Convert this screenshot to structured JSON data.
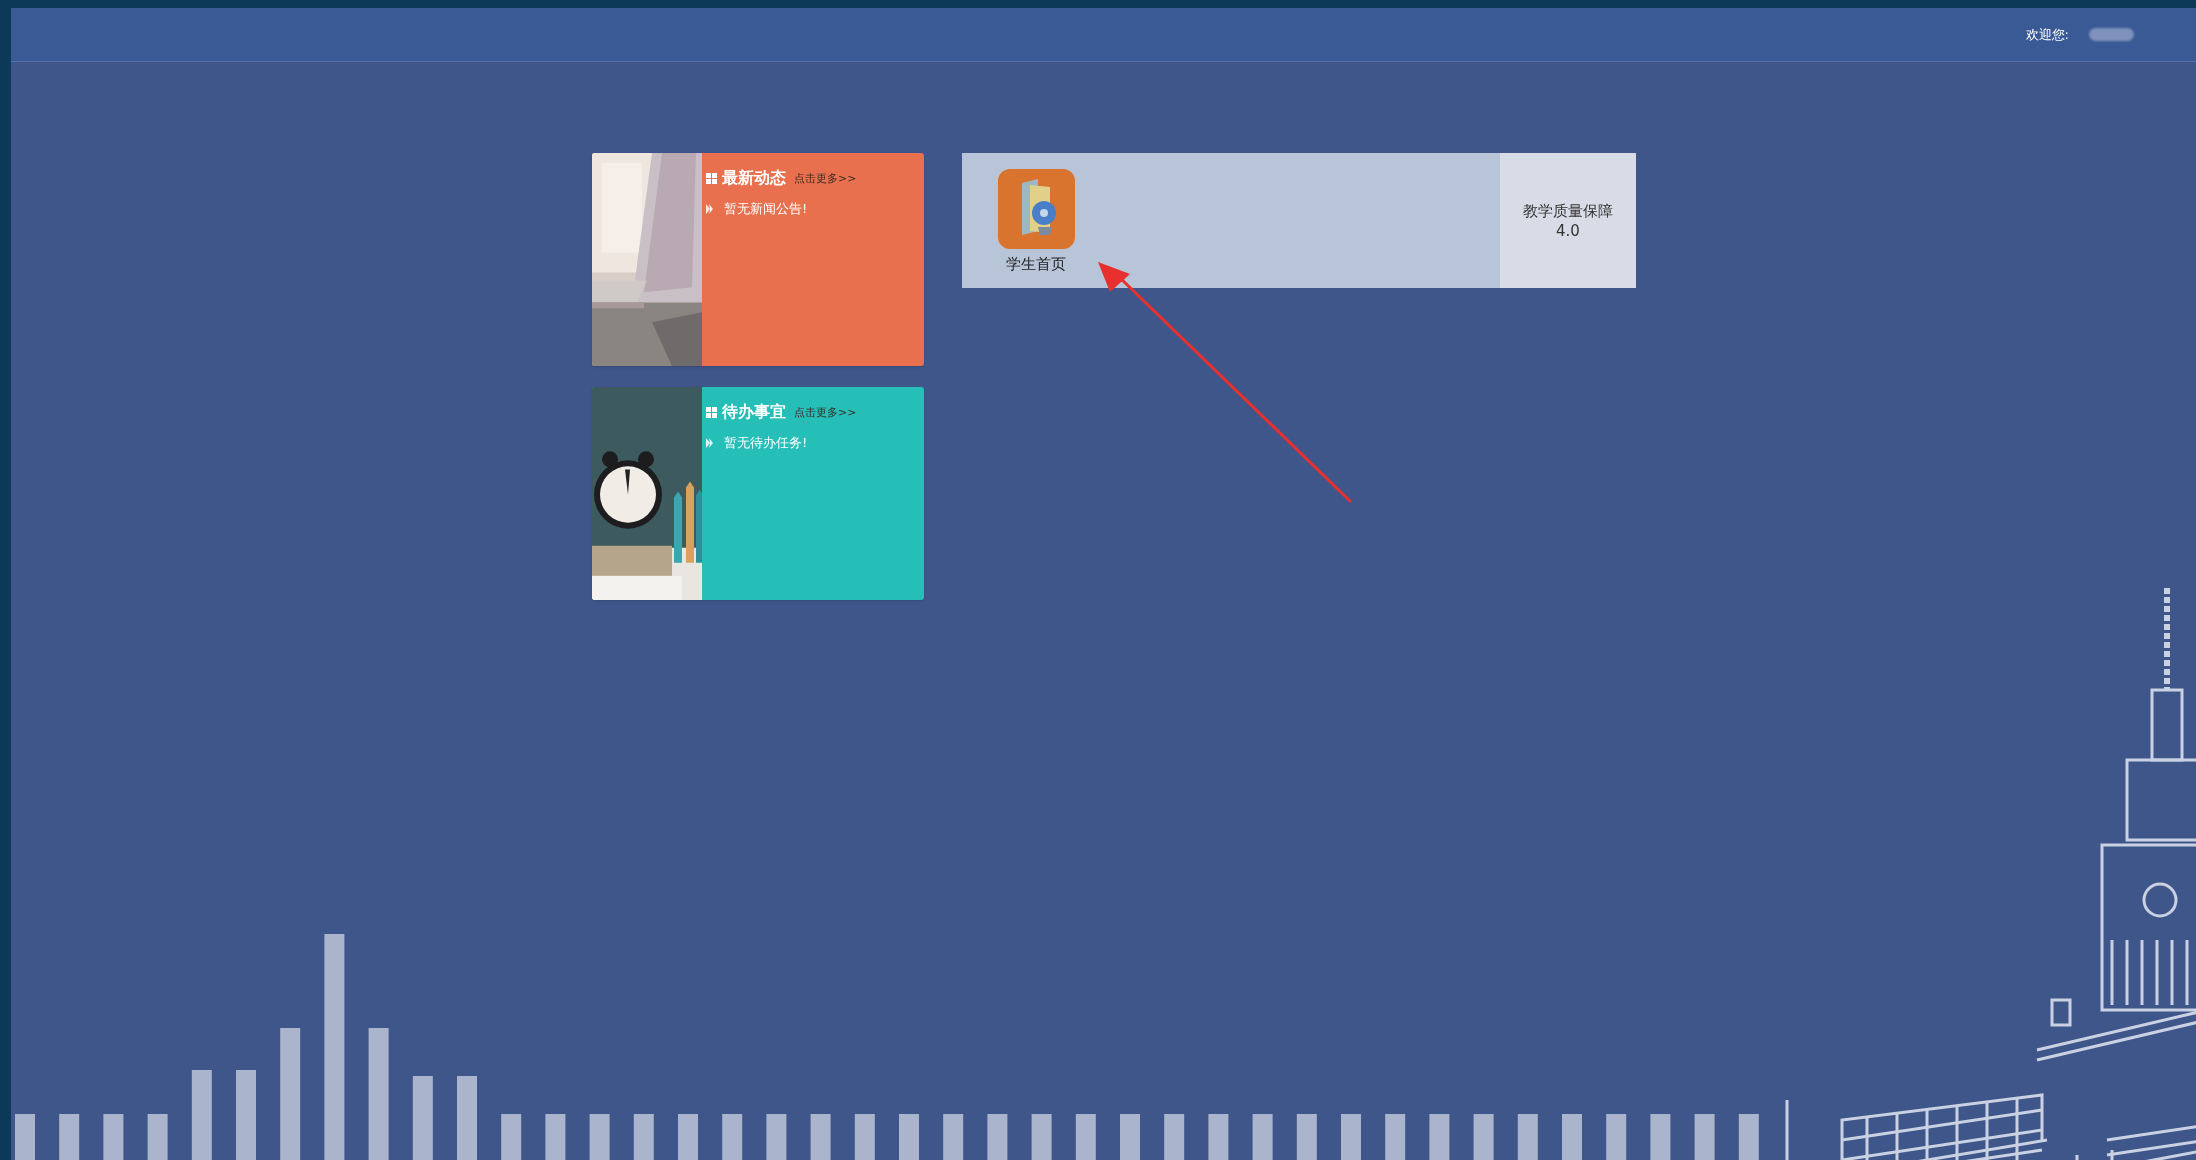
{
  "header": {
    "welcome_label": "欢迎您:"
  },
  "cards": [
    {
      "kind": "news",
      "title": "最新动态",
      "more_link": "点击更多>>",
      "color": "#e8704e",
      "items": [
        "暂无新闻公告!"
      ],
      "picture": {
        "kind": "picture"
      }
    },
    {
      "kind": "todo",
      "title": "待办事宜",
      "more_link": "点击更多>>",
      "color": "#26bfb8",
      "items": [
        "暂无待办任务!"
      ],
      "picture": {
        "kind": "picture"
      }
    }
  ],
  "apps": [
    {
      "label": "学生首页"
    }
  ],
  "system": {
    "title": "教学质量保障",
    "version": "4.0"
  }
}
